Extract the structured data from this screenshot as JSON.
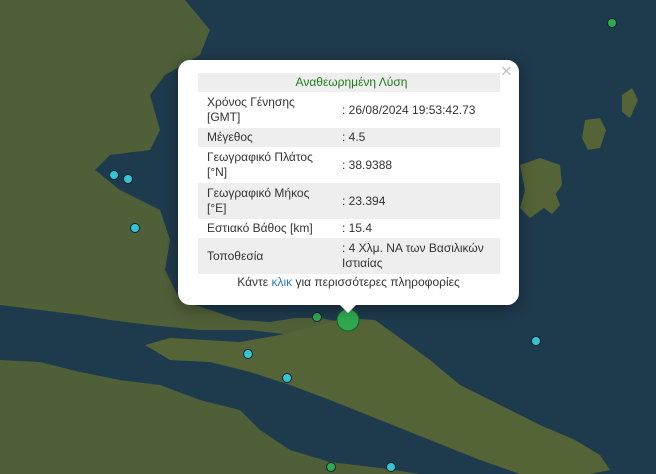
{
  "popup": {
    "close_label": "×",
    "header": "Αναθεωρημένη Λύση",
    "rows": [
      {
        "key": "Χρόνος Γένησης [GMT]",
        "value": ": 26/08/2024 19:53:42.73"
      },
      {
        "key": "Μέγεθος",
        "value": ": 4.5"
      },
      {
        "key": "Γεωγραφικό Πλάτος [°N]",
        "value": ": 38.9388"
      },
      {
        "key": "Γεωγραφικό Μήκος [°E]",
        "value": ": 23.394"
      },
      {
        "key": "Εστιακό Βάθος [km]",
        "value": ": 15.4"
      },
      {
        "key": "Τοποθεσία",
        "value": ": 4 Χλμ. ΝΑ των Βασιλικών Ιστιαίας"
      }
    ],
    "footer_pre": "Κάντε ",
    "footer_link": "κλικ",
    "footer_post": " για περισσότερες πληροφορίες"
  },
  "colors": {
    "sea": "#1e3a4d",
    "land": "#4f5f38",
    "marker_green": "#2fa84f",
    "marker_cyan": "#35c4d0",
    "header_text": "#1a7e1a",
    "link": "#2b7fbf"
  },
  "map": {
    "markers": [
      {
        "type": "cyan",
        "name": "marker-quake-1"
      },
      {
        "type": "cyan",
        "name": "marker-quake-2"
      },
      {
        "type": "cyan",
        "name": "marker-quake-3"
      },
      {
        "type": "cyan",
        "name": "marker-quake-4"
      },
      {
        "type": "cyan",
        "name": "marker-quake-5"
      },
      {
        "type": "cyan",
        "name": "marker-quake-6"
      },
      {
        "type": "cyan",
        "name": "marker-quake-7"
      },
      {
        "type": "green",
        "name": "marker-quake-8"
      },
      {
        "type": "green",
        "name": "marker-quake-9"
      },
      {
        "type": "green",
        "name": "marker-quake-10"
      },
      {
        "type": "green-large",
        "name": "marker-selected-quake"
      }
    ]
  }
}
